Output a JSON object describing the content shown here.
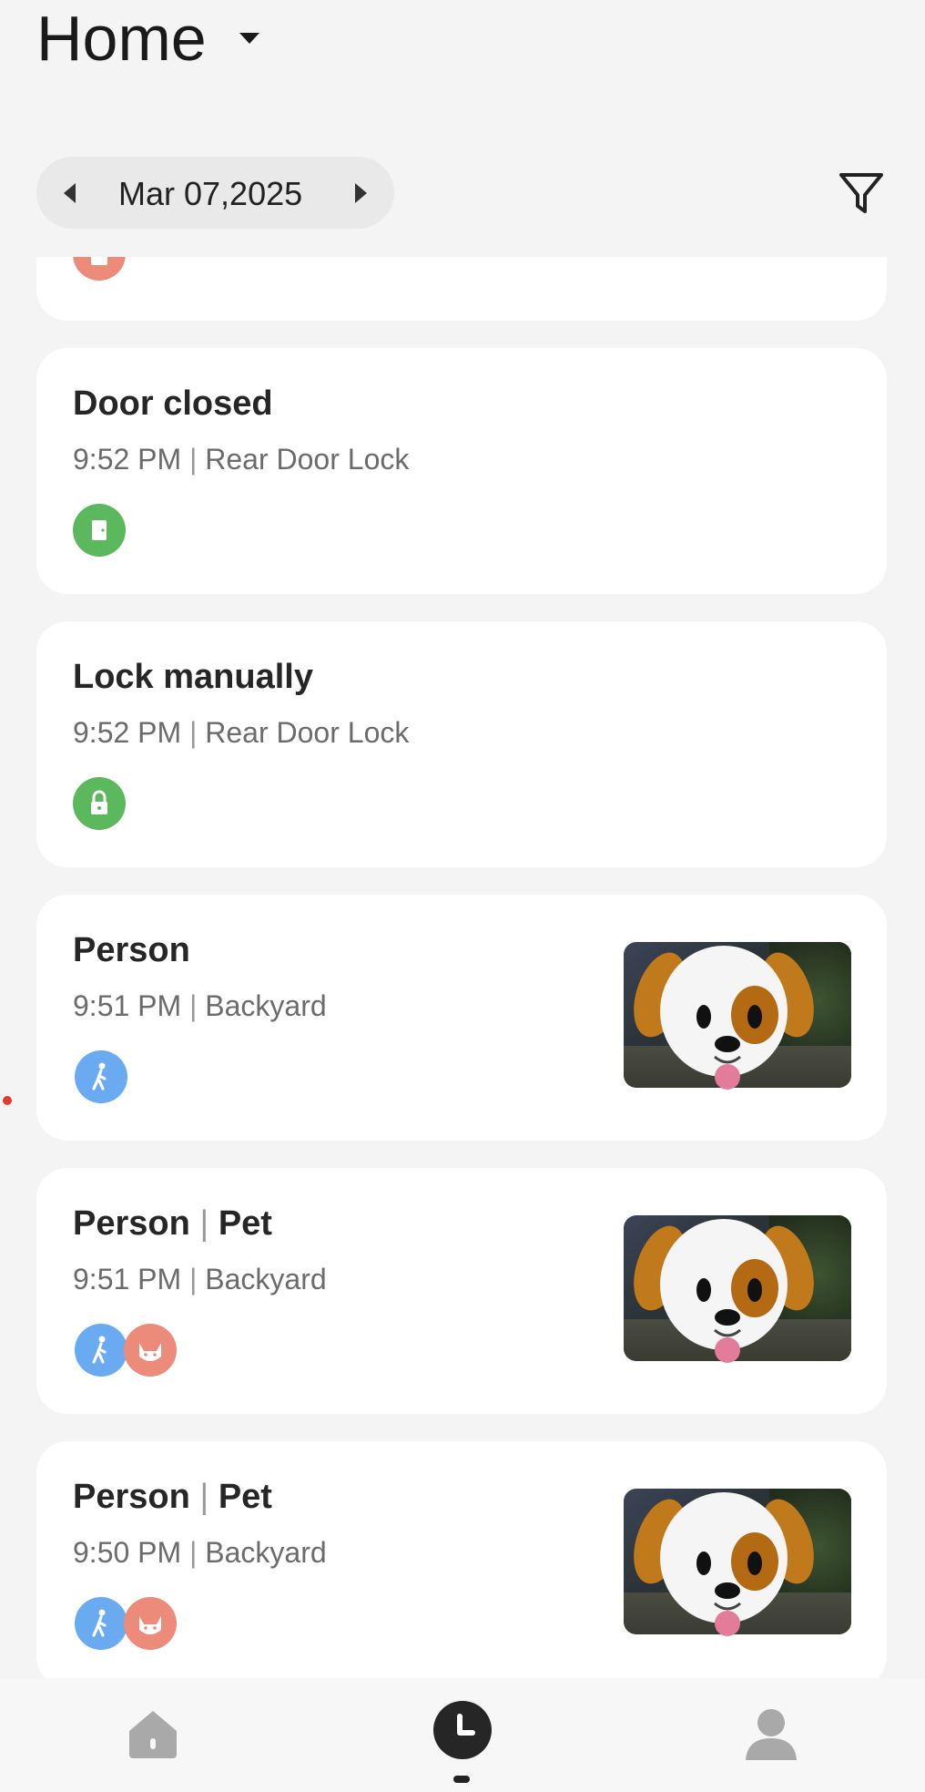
{
  "header": {
    "title": "Home",
    "date": "Mar 07,2025"
  },
  "events": [
    {
      "title": "",
      "time": "",
      "device": "",
      "icons": [
        "lock-icon"
      ]
    },
    {
      "title": "Door closed",
      "time": "9:52 PM",
      "device": "Rear Door Lock",
      "icons": [
        "door-icon"
      ]
    },
    {
      "title": "Lock manually",
      "time": "9:52 PM",
      "device": "Rear Door Lock",
      "icons": [
        "lock-icon"
      ]
    },
    {
      "title_parts": [
        "Person"
      ],
      "time": "9:51 PM",
      "device": "Backyard",
      "icons": [
        "person-walking-icon"
      ],
      "thumbnail": "dog-emoji-thumbnail"
    },
    {
      "title_parts": [
        "Person",
        "Pet"
      ],
      "time": "9:51 PM",
      "device": "Backyard",
      "icons": [
        "person-walking-icon",
        "pet-icon"
      ],
      "thumbnail": "dog-emoji-thumbnail"
    },
    {
      "title_parts": [
        "Person",
        "Pet"
      ],
      "time": "9:50 PM",
      "device": "Backyard",
      "icons": [
        "person-walking-icon",
        "pet-icon"
      ],
      "thumbnail": "dog-emoji-thumbnail"
    }
  ],
  "separator": "|",
  "tabbar": {
    "tabs": [
      "home-icon",
      "history-clock-icon",
      "profile-icon"
    ],
    "active": "history-clock-icon"
  },
  "colors": {
    "green": "#5cb85c",
    "blue": "#6aaaf0",
    "salmon": "#ec8b7a",
    "background": "#f4f4f4",
    "card": "#ffffff"
  }
}
